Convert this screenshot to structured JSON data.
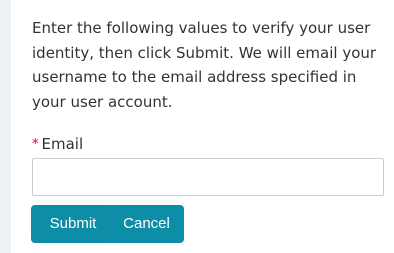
{
  "form": {
    "instructions": "Enter the following values to verify your user identity, then click Submit. We will email your username to the email address specified in your user account.",
    "required_marker": "*",
    "email_label": "Email",
    "email_value": "",
    "submit_label": "Submit",
    "cancel_label": "Cancel"
  },
  "colors": {
    "button_background": "#0e8ea6",
    "required_marker": "#d0021b"
  }
}
